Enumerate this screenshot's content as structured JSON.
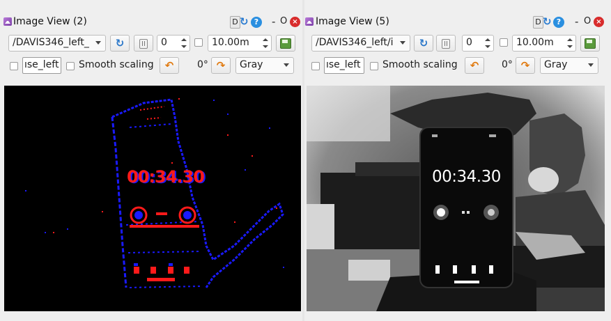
{
  "windows": [
    {
      "title": "Image View (2)",
      "title_buttons": {
        "d_label": "D",
        "help_label": "?",
        "minimize_label": "-",
        "restore_label": "O",
        "close_label": "×"
      },
      "topic": "/DAVIS346_left_",
      "image_number": "0",
      "save_time": "10.00m",
      "topic_field": "ıse_left",
      "smooth_scaling_label": "Smooth scaling",
      "rotation": "0°",
      "colormap": "Gray",
      "view_type": "event-camera",
      "clock_text": "00:34.30"
    },
    {
      "title": "Image View (5)",
      "title_buttons": {
        "d_label": "D",
        "help_label": "?",
        "minimize_label": "-",
        "restore_label": "O",
        "close_label": "×"
      },
      "topic": "/DAVIS346_left/i",
      "image_number": "0",
      "save_time": "10.00m",
      "topic_field": "ıse_left",
      "smooth_scaling_label": "Smooth scaling",
      "rotation": "0°",
      "colormap": "Gray",
      "view_type": "grayscale-frame",
      "clock_text": "00:34.30"
    }
  ],
  "colors": {
    "event_positive": "#ff1a1a",
    "event_negative": "#1a1aff",
    "help_blue": "#2a8fe0",
    "close_red": "#d82c2c",
    "rotate_orange": "#e07a10"
  },
  "icons": {
    "title": "image-view-icon",
    "help": "help-icon",
    "reload": "reload-icon",
    "close": "close-icon",
    "refresh": "refresh-topics-icon",
    "pause": "pause-icon",
    "save": "save-image-icon",
    "rotate": "rotate-icon"
  }
}
